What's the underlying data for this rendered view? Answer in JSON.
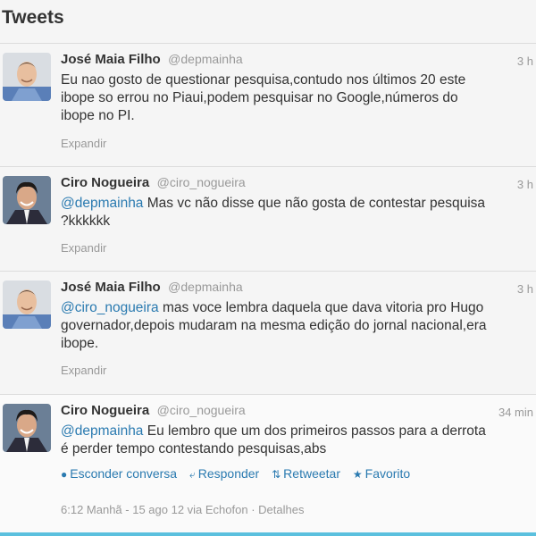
{
  "header": {
    "title": "Tweets"
  },
  "tweets": [
    {
      "name": "José Maia Filho",
      "handle": "@depmainha",
      "time": "3 h",
      "text_lines": [
        "Eu nao gosto de questionar pesquisa,contudo nos últimos 20 este",
        "ibope so errou no Piaui,podem pesquisar no Google,números do",
        "ibope no PI."
      ],
      "expand": "Expandir"
    },
    {
      "name": "Ciro Nogueira",
      "handle": "@ciro_nogueira",
      "time": "3 h",
      "mention": "@depmainha",
      "text_rest_1": " Mas vc não disse que não gosta de contestar pesquisa",
      "text_line_2": "?kkkkkk",
      "expand": "Expandir"
    },
    {
      "name": "José Maia Filho",
      "handle": "@depmainha",
      "time": "3 h",
      "mention": "@ciro_nogueira",
      "text_rest_1": " mas voce lembra daquela que dava vitoria pro Hugo",
      "text_line_2": "governador,depois mudaram na mesma edição do jornal nacional,era",
      "text_line_3": "ibope.",
      "expand": "Expandir"
    },
    {
      "name": "Ciro Nogueira",
      "handle": "@ciro_nogueira",
      "time": "34 min",
      "mention": "@depmainha",
      "text_rest_1": " Eu lembro que um dos primeiros passos para a derrota",
      "text_line_2": "é perder tempo contestando pesquisas,abs",
      "actions": {
        "hide": "Esconder conversa",
        "reply": "Responder",
        "retweet": "Retweetar",
        "favorite": "Favorito"
      },
      "meta": "6:12 Manhã - 15 ago 12 via Echofon · Detalhes"
    }
  ],
  "icons": {
    "hide": "speech-bubble-icon",
    "reply": "reply-arrow-icon",
    "retweet": "retweet-icon",
    "favorite": "star-icon"
  },
  "colors": {
    "link": "#2a7ab0",
    "muted": "#999999",
    "text": "#333333",
    "accent_line": "#5bc0de"
  }
}
